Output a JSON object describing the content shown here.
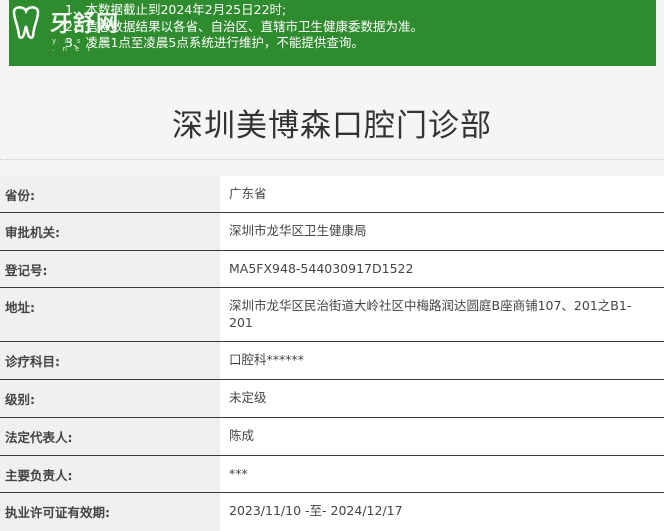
{
  "logo": {
    "brand": "牙舒网",
    "sub": "y a s h u . n e t"
  },
  "notice": {
    "lines": [
      "1、本数据截止到2024年2月25日22时;",
      "2、信息数据结果以各省、自治区、直辖市卫生健康委数据为准。",
      "3、凌晨1点至凌晨5点系统进行维护，不能提供查询。"
    ]
  },
  "clinic": {
    "name": "深圳美博森口腔门诊部"
  },
  "fields": [
    {
      "label": "省份:",
      "value": "广东省"
    },
    {
      "label": "审批机关:",
      "value": "深圳市龙华区卫生健康局"
    },
    {
      "label": "登记号:",
      "value": "MA5FX948-544030917D1522"
    },
    {
      "label": "地址:",
      "value": "深圳市龙华区民治街道大岭社区中梅路润达圆庭B座商铺107、201之B1-201"
    },
    {
      "label": "诊疗科目:",
      "value": "口腔科******"
    },
    {
      "label": "级别:",
      "value": "未定级"
    },
    {
      "label": "法定代表人:",
      "value": "陈成"
    },
    {
      "label": "主要负责人:",
      "value": "***"
    },
    {
      "label": "执业许可证有效期:",
      "value": "2023/11/10 -至- 2024/12/17"
    }
  ]
}
